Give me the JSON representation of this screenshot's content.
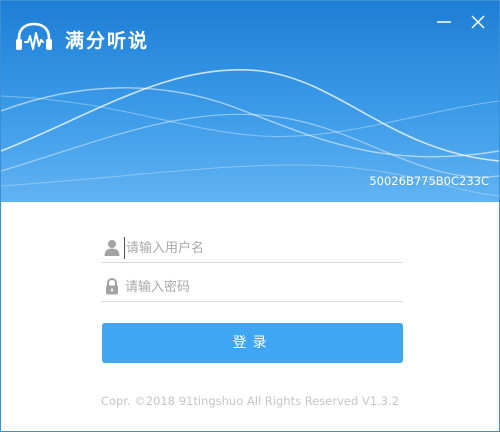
{
  "app": {
    "title": "满分听说",
    "logo_icon": "headphones-icon"
  },
  "window_controls": {
    "minimize_icon": "minimize-icon",
    "close_icon": "close-icon"
  },
  "device": {
    "id": "50026B775B0C233C"
  },
  "form": {
    "username": {
      "icon": "user-icon",
      "value": "",
      "placeholder": "请输入用户名"
    },
    "password": {
      "icon": "lock-icon",
      "value": "",
      "placeholder": "请输入密码"
    },
    "login_label": "登录"
  },
  "footer": {
    "copyright": "Copr. ©2018 91tingshuo All Rights Reserved V1.3.2"
  },
  "colors": {
    "header_top": "#1d7ed6",
    "header_bottom": "#62b3f2",
    "button": "#3fa6f3",
    "placeholder": "#a8a8a8",
    "footer_text": "#c6c6c6"
  }
}
